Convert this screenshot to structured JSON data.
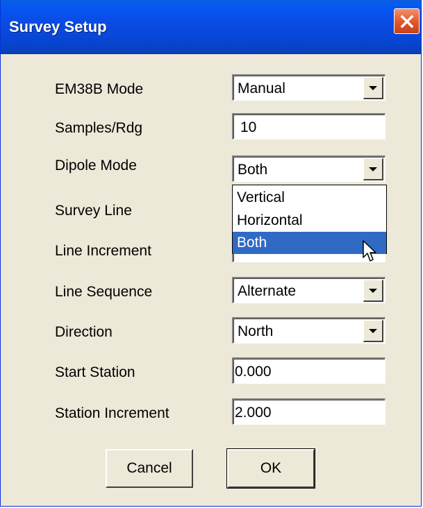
{
  "window": {
    "title": "Survey Setup"
  },
  "form": {
    "em38b_mode": {
      "label": "EM38B Mode",
      "value": "Manual"
    },
    "samples_rdg": {
      "label": "Samples/Rdg",
      "value": "10"
    },
    "dipole_mode": {
      "label": "Dipole Mode",
      "value": "Both",
      "options": [
        "Vertical",
        "Horizontal",
        "Both"
      ],
      "highlighted_option": "Both"
    },
    "survey_line": {
      "label": "Survey Line"
    },
    "line_increment": {
      "label": "Line Increment"
    },
    "line_sequence": {
      "label": "Line Sequence",
      "value": "Alternate"
    },
    "direction": {
      "label": "Direction",
      "value": "North"
    },
    "start_station": {
      "label": "Start Station",
      "value": "0.000"
    },
    "station_increment": {
      "label": "Station Increment",
      "value": "2.000"
    }
  },
  "buttons": {
    "cancel": "Cancel",
    "ok": "OK"
  },
  "icons": {
    "close": "close-icon",
    "dropdown": "chevron-down-icon",
    "cursor": "mouse-pointer-icon"
  },
  "colors": {
    "titlebar": "#0559f2",
    "close_button": "#e35a2c",
    "dialog_background": "#ece9d8",
    "selection": "#316ac5"
  }
}
